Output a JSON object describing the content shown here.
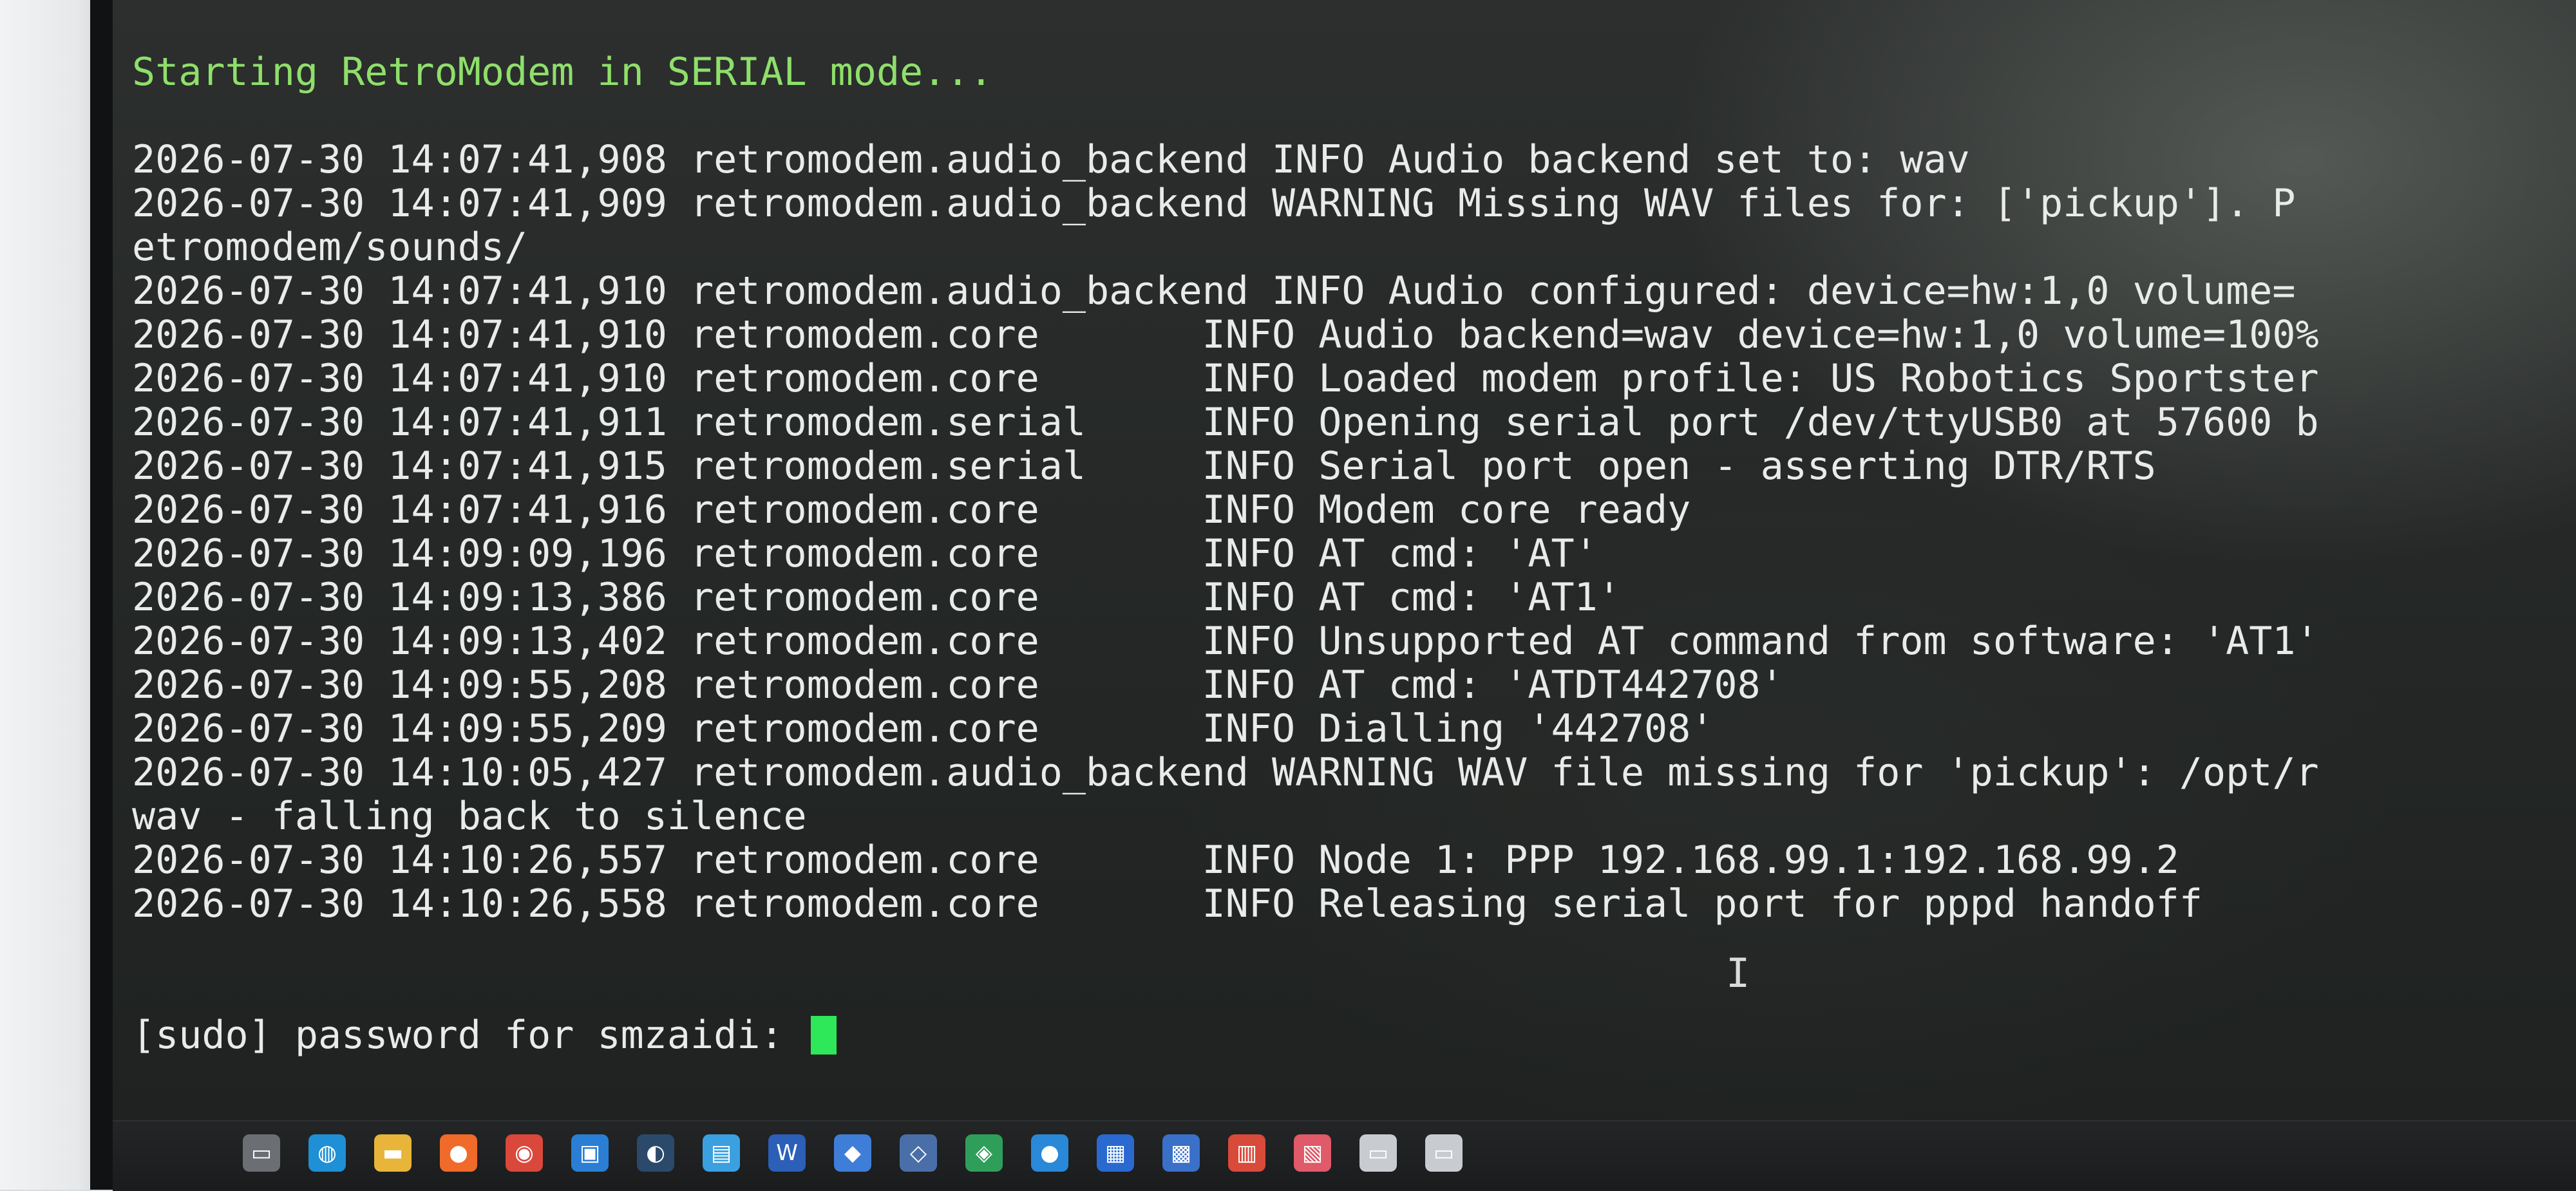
{
  "terminal": {
    "lines": [
      {
        "text": "Starting RetroModem in SERIAL mode...",
        "style": "green"
      },
      {
        "text": "",
        "style": ""
      },
      {
        "text": "2026-07-30 14:07:41,908 retromodem.audio_backend INFO Audio backend set to: wav",
        "style": ""
      },
      {
        "text": "2026-07-30 14:07:41,909 retromodem.audio_backend WARNING Missing WAV files for: ['pickup']. P",
        "style": ""
      },
      {
        "text": "etromodem/sounds/",
        "style": ""
      },
      {
        "text": "2026-07-30 14:07:41,910 retromodem.audio_backend INFO Audio configured: device=hw:1,0 volume=",
        "style": ""
      },
      {
        "text": "2026-07-30 14:07:41,910 retromodem.core       INFO Audio backend=wav device=hw:1,0 volume=100%",
        "style": ""
      },
      {
        "text": "2026-07-30 14:07:41,910 retromodem.core       INFO Loaded modem profile: US Robotics Sportster",
        "style": ""
      },
      {
        "text": "2026-07-30 14:07:41,911 retromodem.serial     INFO Opening serial port /dev/ttyUSB0 at 57600 b",
        "style": ""
      },
      {
        "text": "2026-07-30 14:07:41,915 retromodem.serial     INFO Serial port open - asserting DTR/RTS",
        "style": ""
      },
      {
        "text": "2026-07-30 14:07:41,916 retromodem.core       INFO Modem core ready",
        "style": ""
      },
      {
        "text": "2026-07-30 14:09:09,196 retromodem.core       INFO AT cmd: 'AT'",
        "style": ""
      },
      {
        "text": "2026-07-30 14:09:13,386 retromodem.core       INFO AT cmd: 'AT1'",
        "style": ""
      },
      {
        "text": "2026-07-30 14:09:13,402 retromodem.core       INFO Unsupported AT command from software: 'AT1'",
        "style": ""
      },
      {
        "text": "2026-07-30 14:09:55,208 retromodem.core       INFO AT cmd: 'ATDT442708'",
        "style": ""
      },
      {
        "text": "2026-07-30 14:09:55,209 retromodem.core       INFO Dialling '442708'",
        "style": ""
      },
      {
        "text": "2026-07-30 14:10:05,427 retromodem.audio_backend WARNING WAV file missing for 'pickup': /opt/r",
        "style": ""
      },
      {
        "text": "wav - falling back to silence",
        "style": ""
      },
      {
        "text": "2026-07-30 14:10:26,557 retromodem.core       INFO Node 1: PPP 192.168.99.1:192.168.99.2",
        "style": ""
      },
      {
        "text": "2026-07-30 14:10:26,558 retromodem.core       INFO Releasing serial port for pppd handoff",
        "style": ""
      }
    ],
    "prompt": "[sudo] password for smzaidi: "
  },
  "taskbar": {
    "icons": [
      {
        "name": "start-icon",
        "glyph": "",
        "color": "#2f9cf0"
      },
      {
        "name": "task-view-icon",
        "glyph": "▭",
        "color": "#6b6f73"
      },
      {
        "name": "edge-icon",
        "glyph": "◍",
        "color": "#1f8fd6"
      },
      {
        "name": "file-explorer-icon",
        "glyph": "▬",
        "color": "#e8b53a"
      },
      {
        "name": "firefox-icon",
        "glyph": "●",
        "color": "#f06a2a"
      },
      {
        "name": "chrome-icon",
        "glyph": "◉",
        "color": "#d9483b"
      },
      {
        "name": "remote-icon",
        "glyph": "▣",
        "color": "#2a7fd4"
      },
      {
        "name": "steam-icon",
        "glyph": "◐",
        "color": "#2b4a6b"
      },
      {
        "name": "photos-icon",
        "glyph": "▤",
        "color": "#3aa0e0"
      },
      {
        "name": "word-icon",
        "glyph": "W",
        "color": "#2b5fb8"
      },
      {
        "name": "app-icon-1",
        "glyph": "◆",
        "color": "#3e7ed8"
      },
      {
        "name": "app-icon-2",
        "glyph": "◇",
        "color": "#4a6fa8"
      },
      {
        "name": "app-icon-3",
        "glyph": "◈",
        "color": "#2f9e5a"
      },
      {
        "name": "app-icon-4",
        "glyph": "●",
        "color": "#2a88d8"
      },
      {
        "name": "app-icon-5",
        "glyph": "▦",
        "color": "#2a6ad0"
      },
      {
        "name": "app-icon-6",
        "glyph": "▩",
        "color": "#3a70c8"
      },
      {
        "name": "app-icon-7",
        "glyph": "▥",
        "color": "#d84a3a"
      },
      {
        "name": "app-icon-8",
        "glyph": "▧",
        "color": "#e05a6a"
      },
      {
        "name": "app-icon-9",
        "glyph": "▭",
        "color": "#c8ccd0"
      },
      {
        "name": "app-icon-10",
        "glyph": "▭",
        "color": "#c8ccd0"
      }
    ]
  }
}
